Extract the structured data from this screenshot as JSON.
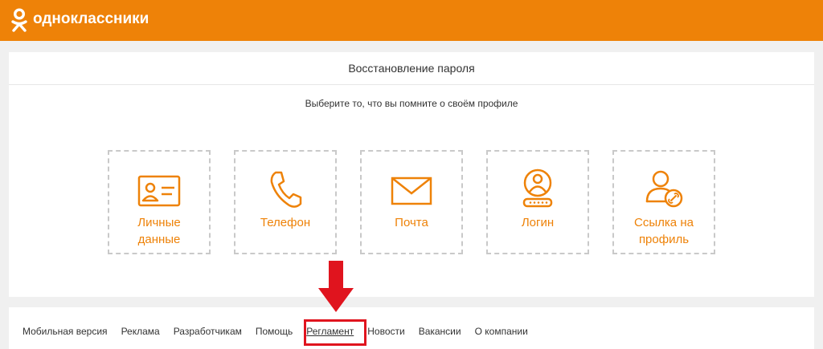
{
  "header": {
    "brand": "одноклассники",
    "logo_icon": "odnoklassniki-logo-icon",
    "bg_color": "#ee8208"
  },
  "recovery": {
    "title": "Восстановление пароля",
    "subtitle": "Выберите то, что вы помните о своём профиле",
    "options": [
      {
        "icon": "id-card-icon",
        "line1": "Личные",
        "line2": "данные"
      },
      {
        "icon": "phone-icon",
        "line1": "Телефон",
        "line2": ""
      },
      {
        "icon": "mail-icon",
        "line1": "Почта",
        "line2": ""
      },
      {
        "icon": "user-login-icon",
        "line1": "Логин",
        "line2": ""
      },
      {
        "icon": "user-link-icon",
        "line1": "Ссылка на",
        "line2": "профиль"
      }
    ]
  },
  "footer": {
    "links": [
      "Мобильная версия",
      "Реклама",
      "Разработчикам",
      "Помощь",
      "Регламент",
      "Новости",
      "Вакансии",
      "О компании"
    ],
    "highlighted_link": "Регламент"
  },
  "annotation": {
    "color": "#e0141e",
    "arrow_icon": "down-arrow-icon"
  }
}
